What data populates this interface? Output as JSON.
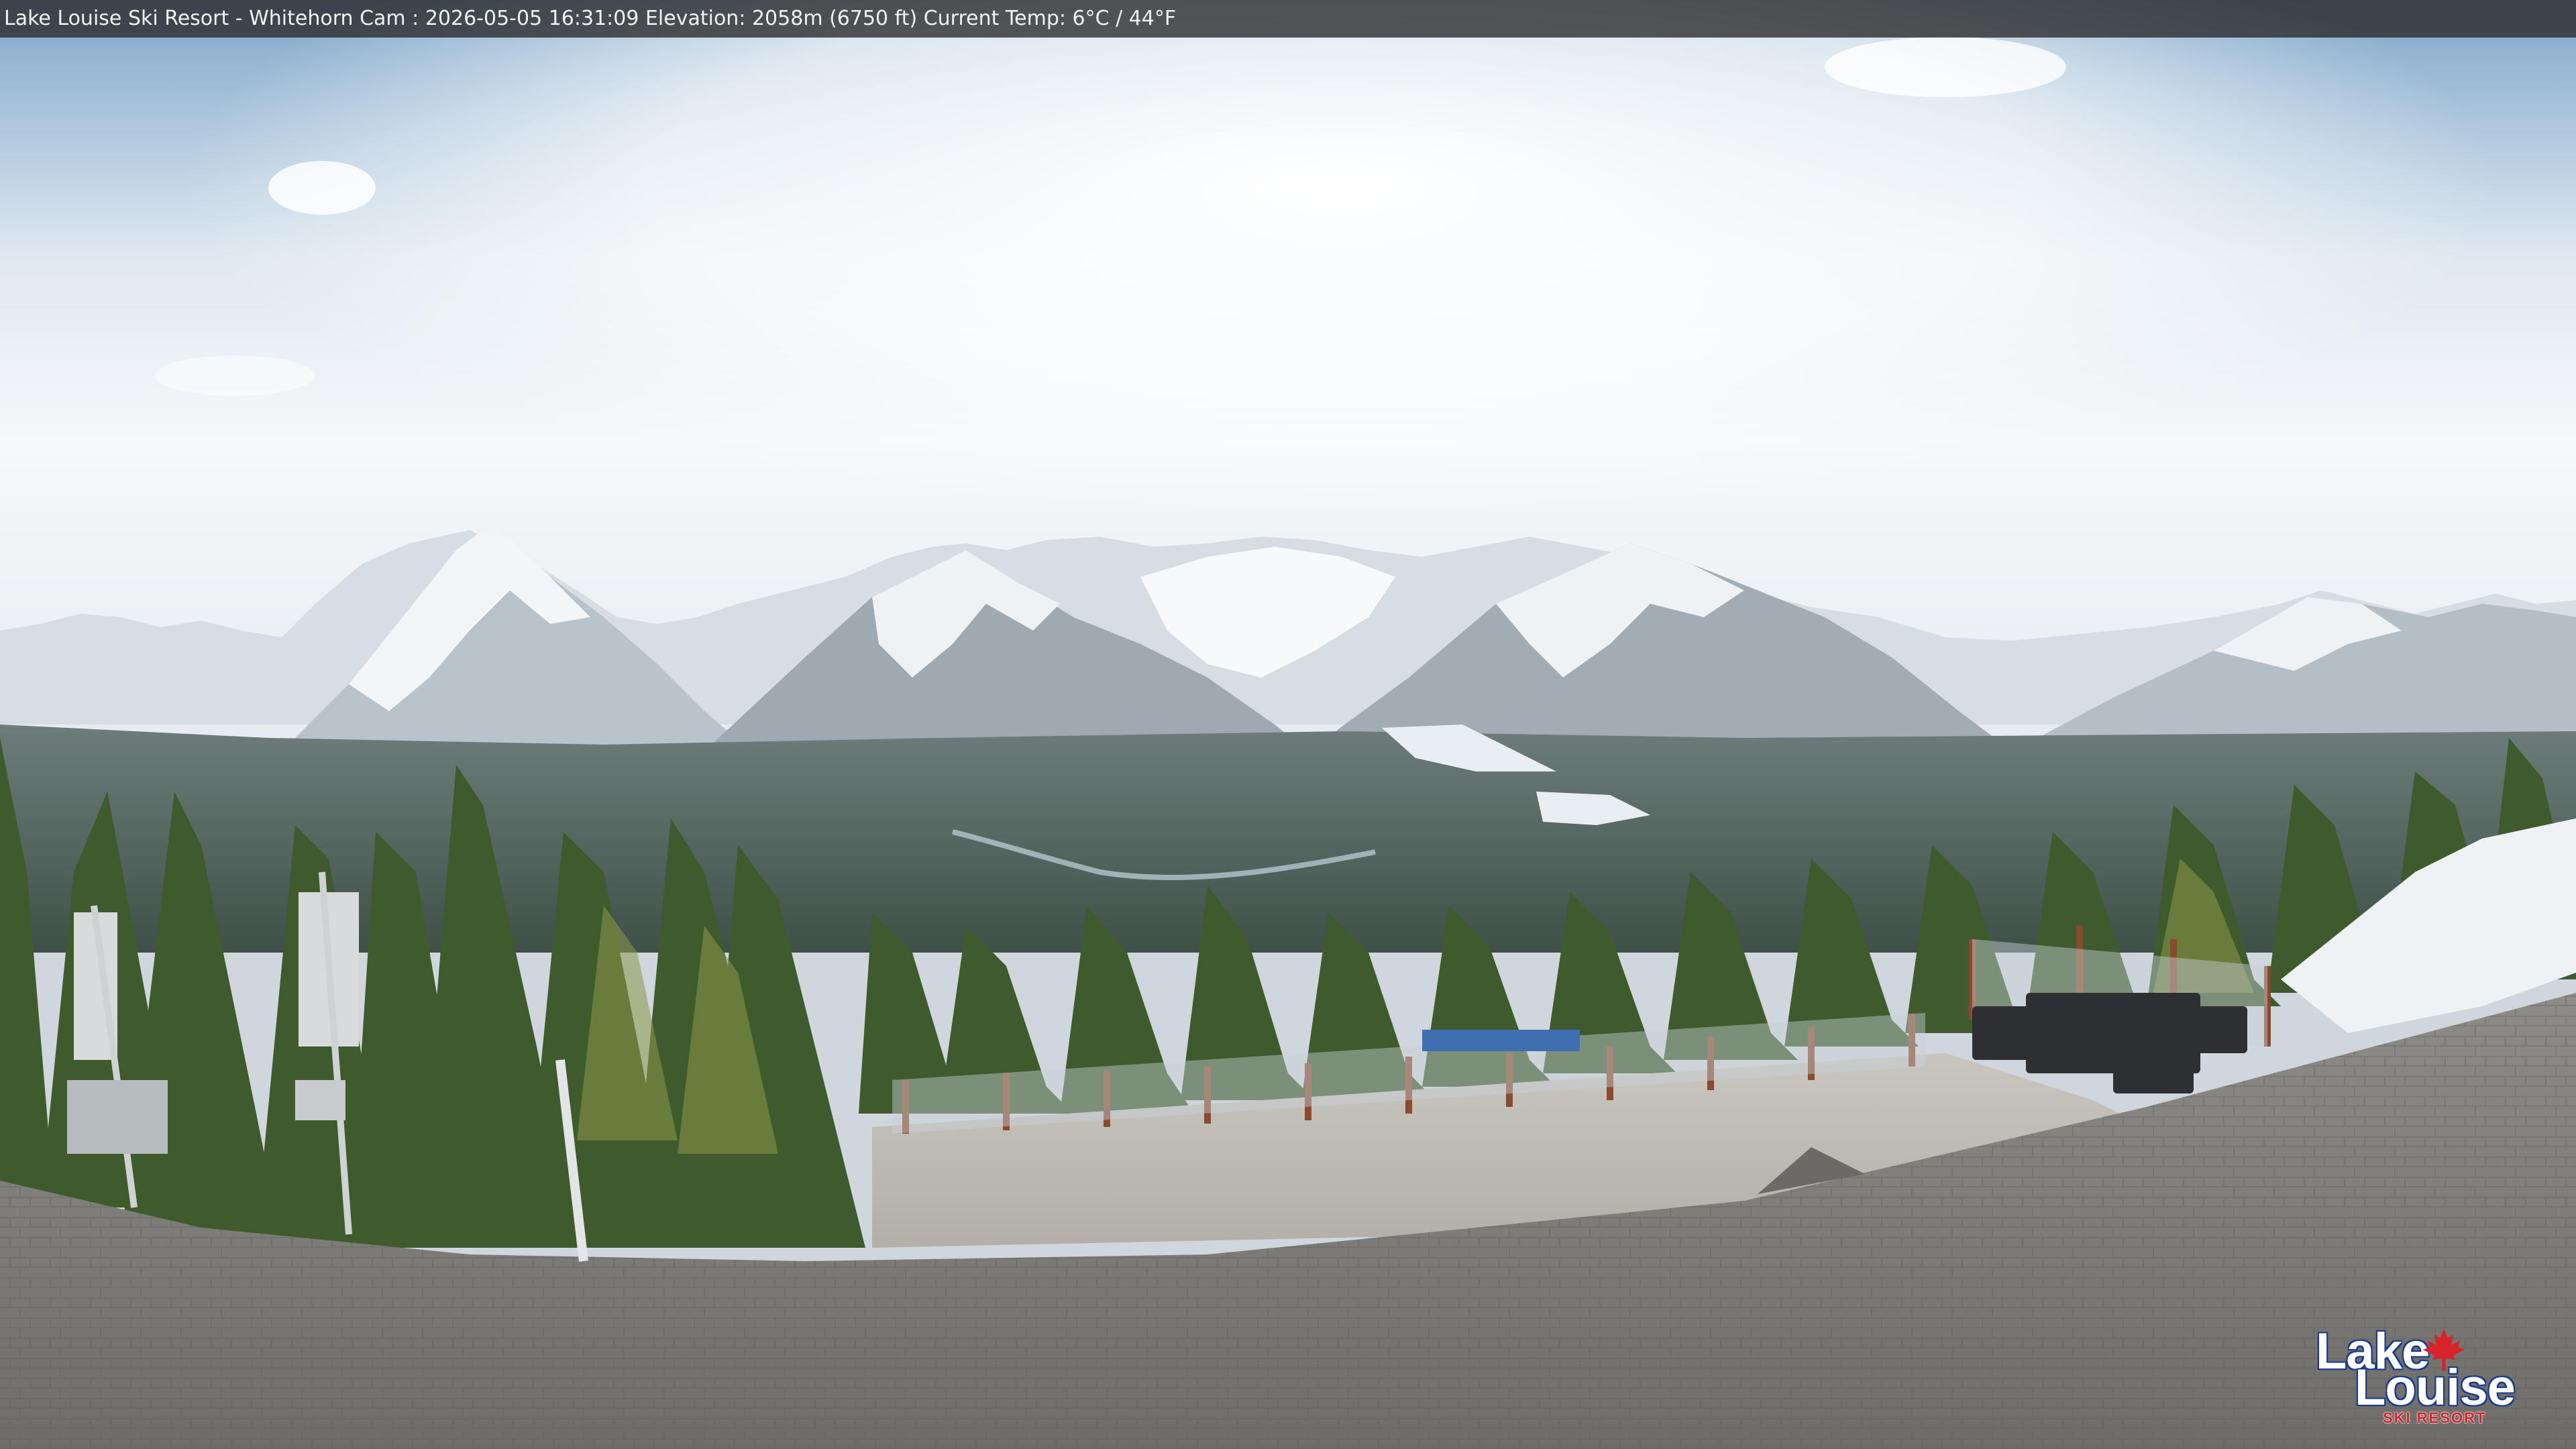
{
  "camera": {
    "overlay_text": "Lake Louise Ski Resort - Whitehorn Cam : 2026-05-05 16:31:09  Elevation: 2058m (6750 ft) Current Temp: 6°C / 44°F"
  },
  "logo": {
    "line1": "Lake",
    "line2": "Louise",
    "line3": "SKI RESORT",
    "icon": "maple-leaf-icon",
    "color_red": "#d8232a",
    "color_blue": "#1a3c8c"
  }
}
